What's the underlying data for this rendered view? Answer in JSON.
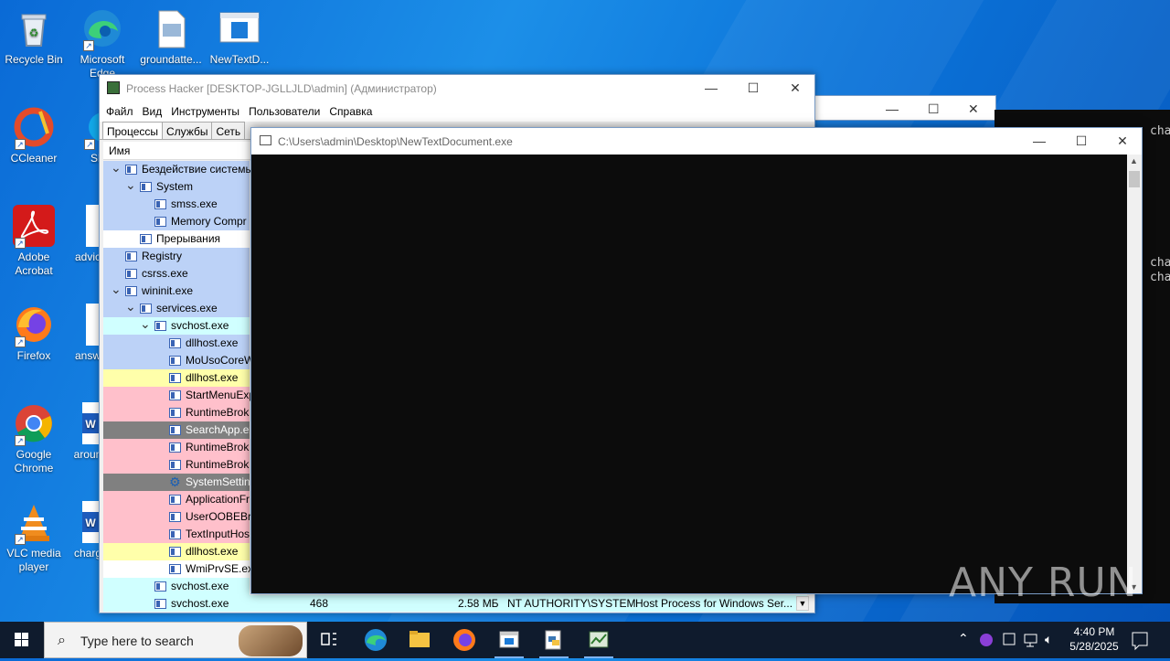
{
  "desktop": {
    "icons": [
      {
        "label": "Recycle Bin",
        "icon": "recycle-bin-icon"
      },
      {
        "label": "Microsoft Edge",
        "icon": "edge-icon"
      },
      {
        "label": "groundatte...",
        "icon": "image-file-icon"
      },
      {
        "label": "NewTextD...",
        "icon": "exe-window-icon"
      },
      {
        "label": "CCleaner",
        "icon": "ccleaner-icon"
      },
      {
        "label": "Sk",
        "icon": "skype-icon"
      },
      {
        "label": "Adobe Acrobat",
        "icon": "acrobat-icon"
      },
      {
        "label": "advic",
        "icon": "document-icon"
      },
      {
        "label": "Firefox",
        "icon": "firefox-icon"
      },
      {
        "label": "answ",
        "icon": "document-icon"
      },
      {
        "label": "Google Chrome",
        "icon": "chrome-icon"
      },
      {
        "label": "aroun",
        "icon": "word-icon"
      },
      {
        "label": "VLC media player",
        "icon": "vlc-icon"
      },
      {
        "label": "charg",
        "icon": "word-icon"
      }
    ]
  },
  "background_console": {
    "lines": [
      "cha",
      "cha",
      "cha"
    ]
  },
  "process_hacker": {
    "title": "Process Hacker [DESKTOP-JGLLJLD\\admin] (Администратор)",
    "menu": [
      "Файл",
      "Вид",
      "Инструменты",
      "Пользователи",
      "Справка"
    ],
    "tabs": [
      "Процессы",
      "Службы",
      "Сеть"
    ],
    "column_name": "Имя",
    "rows": [
      {
        "name": "Бездействие системы",
        "bg": "#bcd2f7"
      },
      {
        "name": "System",
        "bg": "#bcd2f7"
      },
      {
        "name": "smss.exe",
        "bg": "#bcd2f7"
      },
      {
        "name": "Memory Compr",
        "bg": "#bcd2f7"
      },
      {
        "name": "Прерывания",
        "bg": "#ffffff"
      },
      {
        "name": "Registry",
        "bg": "#bcd2f7"
      },
      {
        "name": "csrss.exe",
        "bg": "#bcd2f7"
      },
      {
        "name": "wininit.exe",
        "bg": "#bcd2f7"
      },
      {
        "name": "services.exe",
        "bg": "#bcd2f7"
      },
      {
        "name": "svchost.exe",
        "bg": "#d0ffff"
      },
      {
        "name": "dllhost.exe",
        "bg": "#bcd2f7"
      },
      {
        "name": "MoUsoCoreW",
        "bg": "#bcd2f7"
      },
      {
        "name": "dllhost.exe",
        "bg": "#ffffaa"
      },
      {
        "name": "StartMenuExp",
        "bg": "#ffc0cb"
      },
      {
        "name": "RuntimeBrok",
        "bg": "#ffc0cb"
      },
      {
        "name": "SearchApp.ex",
        "bg": "#808080"
      },
      {
        "name": "RuntimeBrok",
        "bg": "#ffc0cb"
      },
      {
        "name": "RuntimeBrok",
        "bg": "#ffc0cb"
      },
      {
        "name": "SystemSetting",
        "bg": "#808080"
      },
      {
        "name": "ApplicationFr",
        "bg": "#ffc0cb"
      },
      {
        "name": "UserOOBEBro",
        "bg": "#ffc0cb"
      },
      {
        "name": "TextInputHos",
        "bg": "#ffc0cb"
      },
      {
        "name": "dllhost.exe",
        "bg": "#ffffaa"
      },
      {
        "name": "WmiPrvSE.exe",
        "bg": "#ffffff"
      },
      {
        "name": "svchost.exe",
        "bg": "#d0ffff"
      },
      {
        "name": "svchost.exe",
        "bg": "#d0ffff",
        "pid": "468",
        "memory": "2.58 МБ",
        "user": "NT AUTHORITY\\SYSTEM",
        "description": "Host Process for Windows Ser..."
      }
    ]
  },
  "console": {
    "title": "C:\\Users\\admin\\Desktop\\NewTextDocument.exe"
  },
  "watermark": "ANY RUN",
  "taskbar": {
    "search_placeholder": "Type here to search",
    "time": "4:40 PM",
    "date": "5/28/2025",
    "pinned": [
      "task-view-icon",
      "edge-icon",
      "file-explorer-icon",
      "firefox-icon",
      "window-app-icon",
      "python-file-icon",
      "process-hacker-icon"
    ]
  }
}
